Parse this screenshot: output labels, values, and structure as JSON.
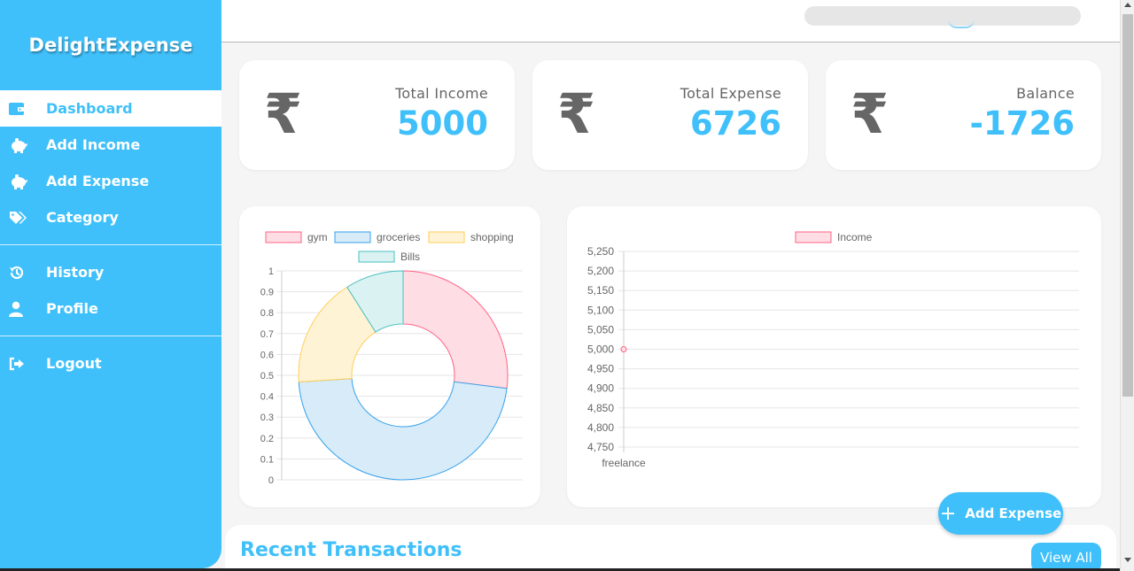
{
  "brand": "DelightExpense",
  "nav": [
    {
      "label": "Dashboard",
      "icon": "wallet-icon",
      "active": true
    },
    {
      "label": "Add Income",
      "icon": "piggy-bank-icon"
    },
    {
      "label": "Add Expense",
      "icon": "piggy-bank-icon"
    },
    {
      "label": "Category",
      "icon": "tags-icon"
    },
    {
      "label": "History",
      "icon": "history-icon"
    },
    {
      "label": "Profile",
      "icon": "user-icon"
    },
    {
      "label": "Logout",
      "icon": "logout-icon"
    }
  ],
  "stats": [
    {
      "label": "Total Income",
      "value": "5000",
      "icon": "rupee-icon",
      "symbol": "₹"
    },
    {
      "label": "Total Expense",
      "value": "6726",
      "icon": "rupee-icon",
      "symbol": "₹"
    },
    {
      "label": "Balance",
      "value": "-1726",
      "icon": "rupee-icon",
      "symbol": "₹"
    }
  ],
  "colors": {
    "accent": "#40c0fa",
    "text": "#666666"
  },
  "chart_data": [
    {
      "type": "pie",
      "variant": "doughnut",
      "categories": [
        "gym",
        "groceries",
        "shopping",
        "Bills"
      ],
      "values": [
        27,
        47,
        17,
        9
      ],
      "colors_border": [
        "#ff6384",
        "#36a2eb",
        "#ffce56",
        "#4bc0c0"
      ],
      "colors_fill": [
        "#ffdde4",
        "#d7ebf9",
        "#fff3d6",
        "#dbf2f2"
      ],
      "y_ticks": [
        "0",
        "0.1",
        "0.2",
        "0.3",
        "0.4",
        "0.5",
        "0.6",
        "0.7",
        "0.8",
        "0.9",
        "1"
      ],
      "ylim": [
        0,
        1
      ],
      "grid": true,
      "legend": "top"
    },
    {
      "type": "line",
      "categories": [
        "freelance"
      ],
      "series": [
        {
          "name": "Income",
          "values": [
            5000
          ],
          "color": "#ff6384"
        }
      ],
      "y_ticks": [
        "4,750",
        "4,800",
        "4,850",
        "4,900",
        "4,950",
        "5,000",
        "5,050",
        "5,100",
        "5,150",
        "5,200",
        "5,250"
      ],
      "ylim": [
        4750,
        5250
      ],
      "grid": true,
      "legend": "top"
    }
  ],
  "fab": {
    "icon": "plus-icon",
    "label": "Add Expense"
  },
  "recent": {
    "title": "Recent Transactions",
    "view_all": "View All"
  }
}
